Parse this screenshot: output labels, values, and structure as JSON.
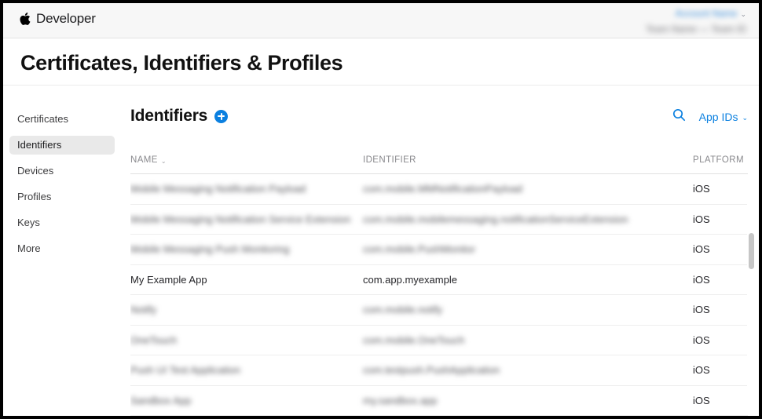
{
  "header": {
    "brand": "Developer",
    "apple_logo_glyph": "",
    "account_name": "Account Name",
    "account_team": "Team Name — Team ID",
    "chevron_glyph": "⌄"
  },
  "page": {
    "title": "Certificates, Identifiers & Profiles"
  },
  "sidebar": {
    "items": [
      {
        "label": "Certificates",
        "selected": false
      },
      {
        "label": "Identifiers",
        "selected": true
      },
      {
        "label": "Devices",
        "selected": false
      },
      {
        "label": "Profiles",
        "selected": false
      },
      {
        "label": "Keys",
        "selected": false
      },
      {
        "label": "More",
        "selected": false
      }
    ]
  },
  "list": {
    "title": "Identifiers",
    "add_label": "+",
    "search_icon": "search-icon",
    "filter_label": "App IDs",
    "filter_chevron": "⌄"
  },
  "table": {
    "columns": {
      "name": "NAME",
      "identifier": "IDENTIFIER",
      "platform": "PLATFORM"
    },
    "sort_chevron": "⌄",
    "rows": [
      {
        "name": "Mobile Messaging Notification Payload",
        "identifier": "com.mobile.MMNotificationPayload",
        "platform": "iOS",
        "redacted": true
      },
      {
        "name": "Mobile Messaging Notification Service Extension",
        "identifier": "com.mobile.mobilemessaging.notificationServiceExtension",
        "platform": "iOS",
        "redacted": true
      },
      {
        "name": "Mobile Messaging Push Monitoring",
        "identifier": "com.mobile.PushMonitor",
        "platform": "iOS",
        "redacted": true
      },
      {
        "name": "My Example App",
        "identifier": "com.app.myexample",
        "platform": "iOS",
        "redacted": false
      },
      {
        "name": "Notify",
        "identifier": "com.mobile.notify",
        "platform": "iOS",
        "redacted": true
      },
      {
        "name": "OneTouch",
        "identifier": "com.mobile.OneTouch",
        "platform": "iOS",
        "redacted": true
      },
      {
        "name": "Push UI Test Application",
        "identifier": "com.testpush.PushApplication",
        "platform": "iOS",
        "redacted": true
      },
      {
        "name": "Sandbox App",
        "identifier": "my.sandbox.app",
        "platform": "iOS",
        "redacted": true
      }
    ]
  },
  "colors": {
    "accent_blue": "#0b80e0",
    "header_bg": "#f7f7f7",
    "selected_item_bg": "#e9e9e9",
    "divider": "#eeeeee",
    "text_primary": "#26262a",
    "text_muted": "#8a8a8e"
  }
}
